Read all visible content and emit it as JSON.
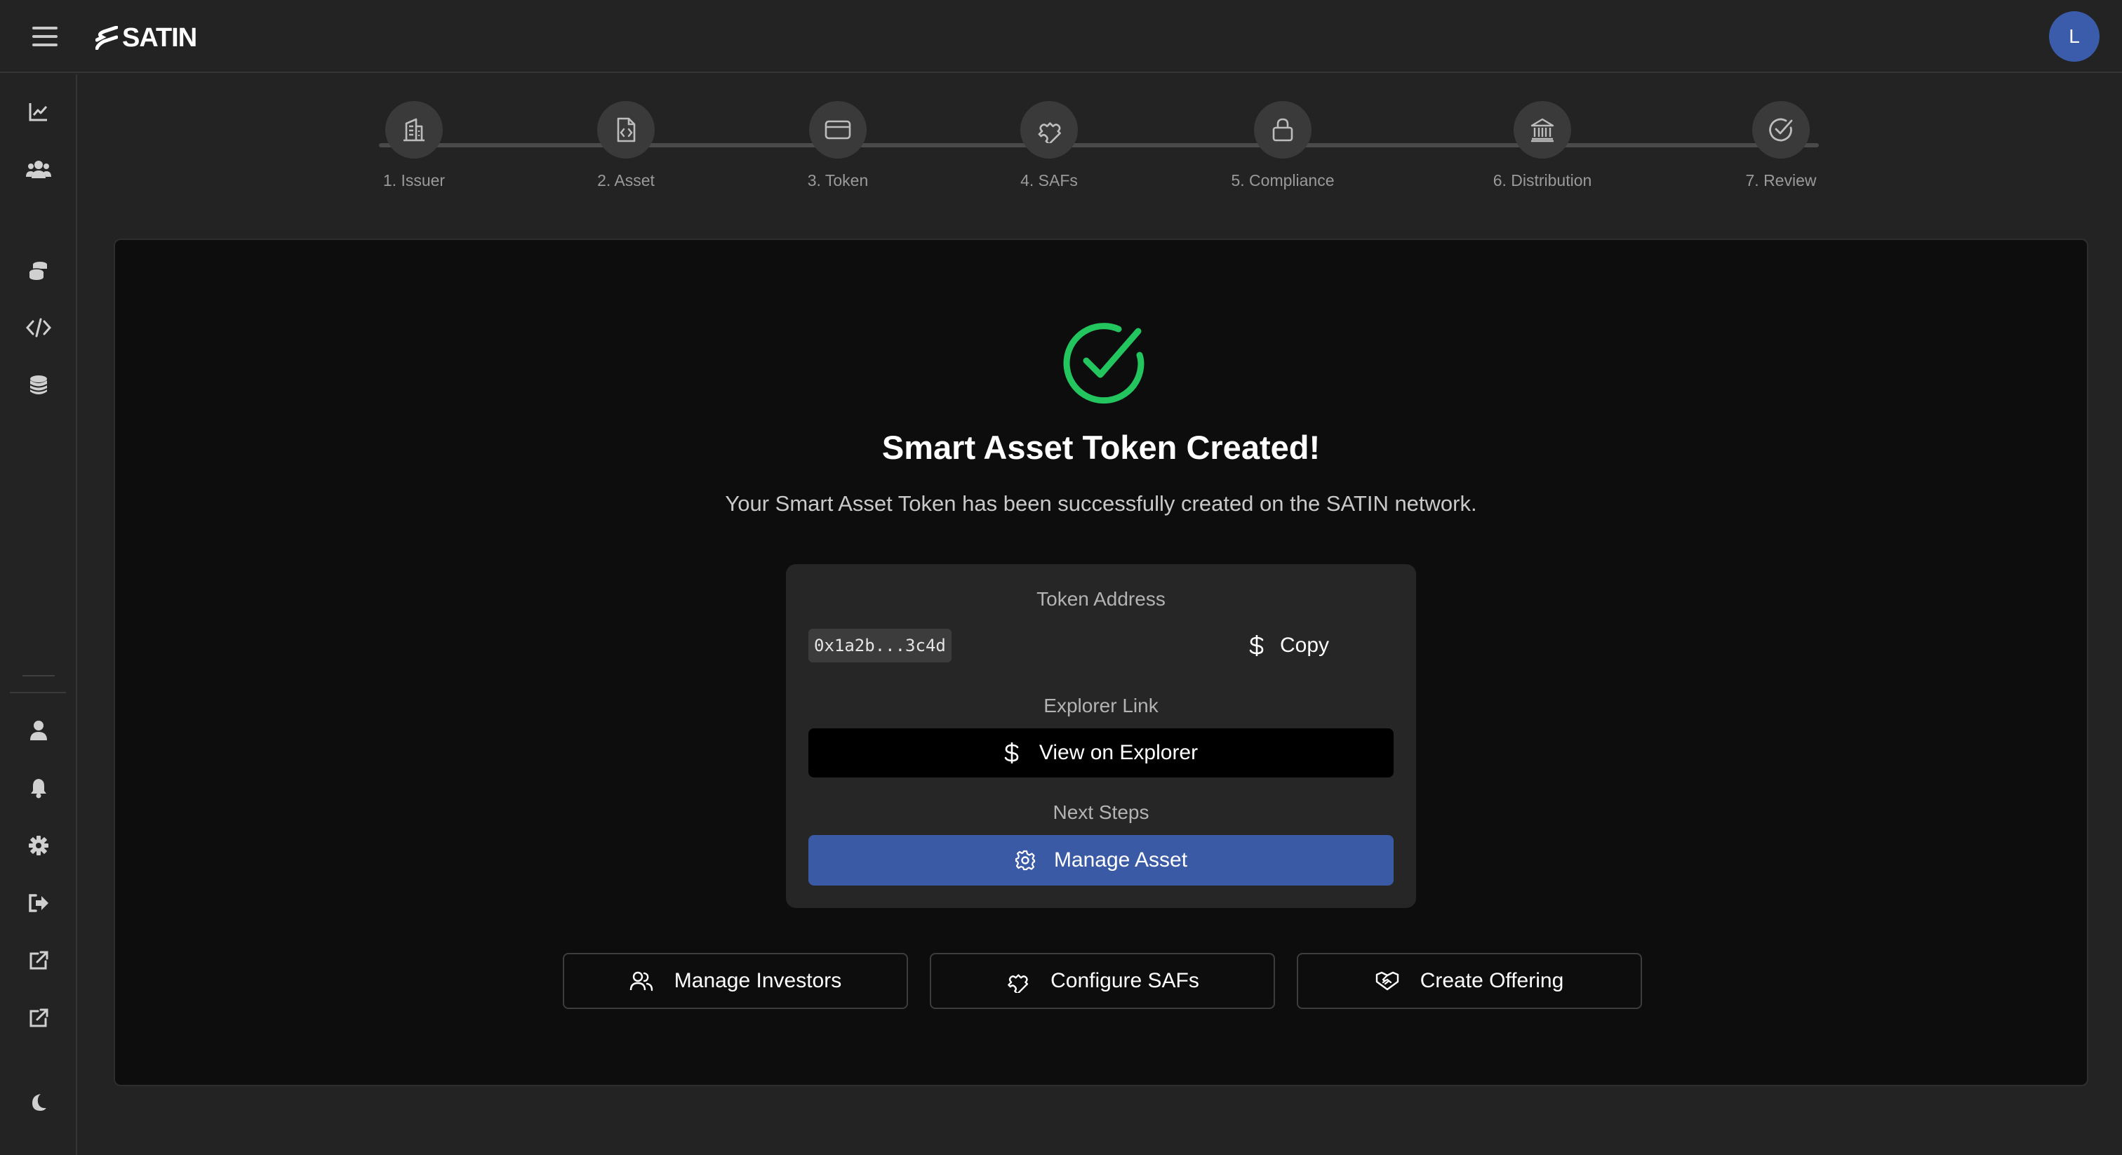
{
  "header": {
    "logo_text": "SATIN",
    "avatar_initial": "L"
  },
  "sidebar": {
    "items": [
      {
        "name": "analytics-icon",
        "icon": "line-chart"
      },
      {
        "name": "users-icon",
        "icon": "users"
      },
      {
        "name": "coins-icon",
        "icon": "coins"
      },
      {
        "name": "code-icon",
        "icon": "code"
      },
      {
        "name": "database-icon",
        "icon": "database"
      },
      {
        "name": "profile-icon",
        "icon": "user"
      },
      {
        "name": "bell-icon",
        "icon": "bell"
      },
      {
        "name": "gear-icon",
        "icon": "gear"
      },
      {
        "name": "logout-icon",
        "icon": "sign-out"
      },
      {
        "name": "external-link-icon",
        "icon": "external-link"
      },
      {
        "name": "external-link-icon-2",
        "icon": "external-link"
      },
      {
        "name": "moon-icon",
        "icon": "moon"
      }
    ]
  },
  "stepper": {
    "steps": [
      {
        "label": "1. Issuer",
        "icon": "building"
      },
      {
        "label": "2. Asset",
        "icon": "file-code"
      },
      {
        "label": "3. Token",
        "icon": "card"
      },
      {
        "label": "4. SAFs",
        "icon": "puzzle"
      },
      {
        "label": "5. Compliance",
        "icon": "lock"
      },
      {
        "label": "6. Distribution",
        "icon": "bank"
      },
      {
        "label": "7. Review",
        "icon": "check-circle"
      }
    ]
  },
  "success": {
    "title": "Smart Asset Token Created!",
    "subtitle": "Your Smart Asset Token has been successfully created on the SATIN network.",
    "accent_color": "#22c55e"
  },
  "token_info": {
    "address_label": "Token Address",
    "address_value": "0x1a2b...3c4d",
    "copy_label": "Copy",
    "explorer_label": "Explorer Link",
    "explorer_button": "View on Explorer",
    "next_steps_label": "Next Steps",
    "manage_asset_button": "Manage Asset",
    "primary_color": "#3a5aa6"
  },
  "actions": {
    "manage_investors": "Manage Investors",
    "configure_safs": "Configure SAFs",
    "create_offering": "Create Offering"
  }
}
